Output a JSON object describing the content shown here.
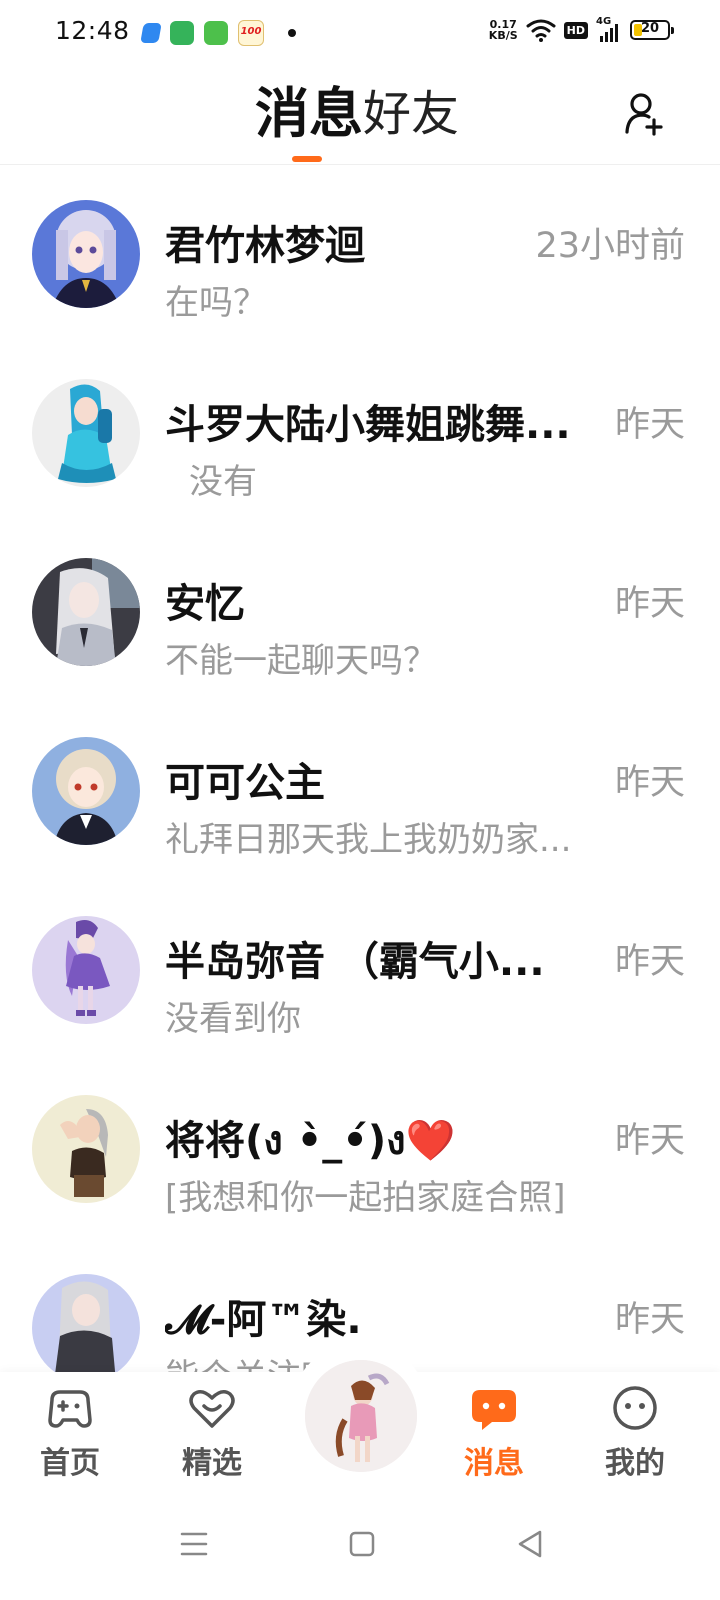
{
  "status_bar": {
    "time": "12:48",
    "net_speed_value": "0.17",
    "net_speed_unit": "KB/S",
    "hd_label": "HD",
    "network_type": "4G",
    "battery": "20",
    "notification_app_icon": "100"
  },
  "header": {
    "tab_messages": "消息",
    "tab_friends": "好友",
    "add_friend_icon": "add-user-icon"
  },
  "conversations": [
    {
      "name": "君竹林梦迴",
      "time": "23小时前",
      "preview": "在吗？"
    },
    {
      "name": "斗罗大陆小舞姐跳舞...",
      "time": "昨天",
      "preview": "没有"
    },
    {
      "name": "安忆",
      "time": "昨天",
      "preview": "不能一起聊天吗？"
    },
    {
      "name": "可可公主",
      "time": "昨天",
      "preview": "礼拜日那天我上我奶奶家..."
    },
    {
      "name": "半岛弥音 （霸气小...",
      "time": "昨天",
      "preview": "没看到你"
    },
    {
      "name": "将将(ง •̀_•́)ง",
      "name_emoji": "❤️",
      "time": "昨天",
      "preview": "[我想和你一起拍家庭合照]"
    },
    {
      "name": "𝓜-阿™染.",
      "time": "昨天",
      "preview": "能个关注吗"
    }
  ],
  "bottom_nav": {
    "home": "首页",
    "featured": "精选",
    "messages": "消息",
    "mine": "我的",
    "active": "messages",
    "accent_color": "#ff6a1a"
  },
  "colors": {
    "accent": "#ff6a1a",
    "secondary_text": "#9a9a9a"
  }
}
